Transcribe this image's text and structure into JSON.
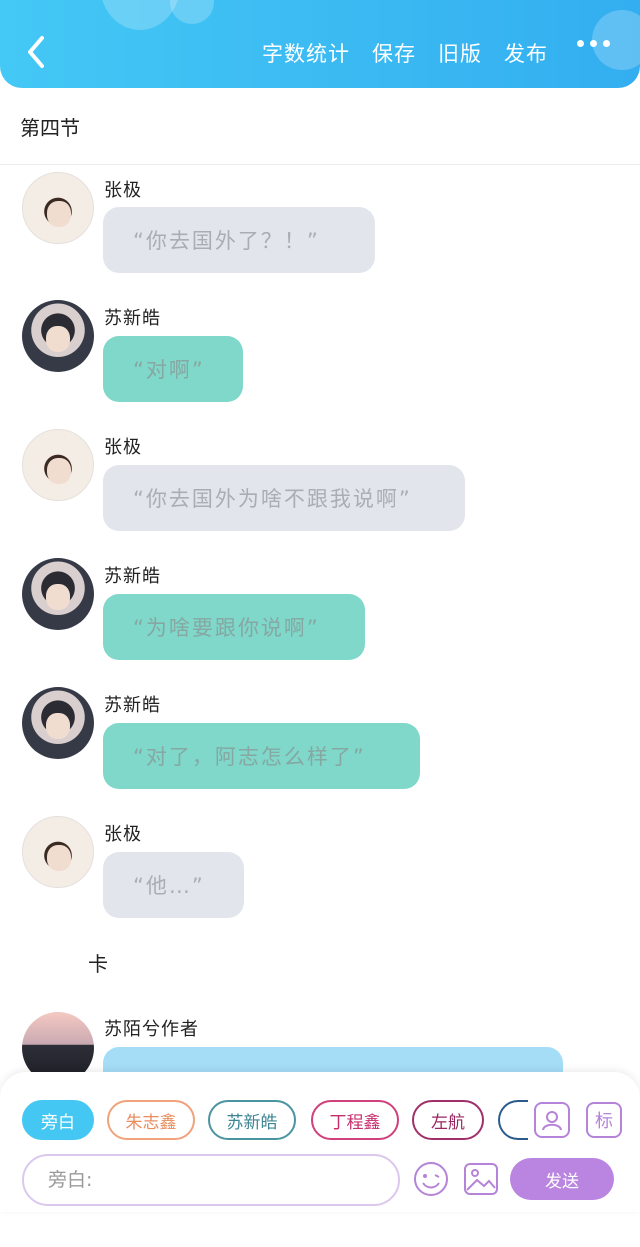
{
  "header": {
    "actions": [
      "字数统计",
      "保存",
      "旧版",
      "发布"
    ]
  },
  "section_title": "第四节",
  "messages": [
    {
      "name": "张极",
      "text": "“你去国外了？！”",
      "style": "gray"
    },
    {
      "name": "苏新皓",
      "text": "“对啊”",
      "style": "teal"
    },
    {
      "name": "张极",
      "text": "“你去国外为啥不跟我说啊”",
      "style": "gray"
    },
    {
      "name": "苏新皓",
      "text": "“为啥要跟你说啊”",
      "style": "teal"
    },
    {
      "name": "苏新皓",
      "text": "“对了，阿志怎么样了”",
      "style": "teal"
    },
    {
      "name": "张极",
      "text": "“他…”",
      "style": "gray"
    }
  ],
  "narration": "卡",
  "last_message": {
    "name": "苏陌兮作者"
  },
  "composer": {
    "characters": [
      "旁白",
      "朱志鑫",
      "苏新皓",
      "丁程鑫",
      "左航"
    ],
    "tag_label": "标",
    "input_placeholder": "旁白:",
    "send_label": "发送"
  },
  "colors": {
    "header_start": "#44c8f5",
    "header_end": "#33aef0",
    "bubble_gray": "#e2e6ec",
    "bubble_teal": "#7fd8ca",
    "send_button": "#b985e0"
  }
}
